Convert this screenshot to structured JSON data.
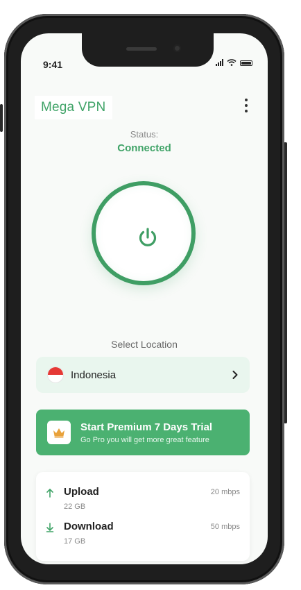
{
  "status_bar": {
    "time": "9:41"
  },
  "app": {
    "title": "Mega VPN",
    "status_label": "Status:",
    "status_value": "Connected"
  },
  "location": {
    "select_label": "Select Location",
    "country": "Indonesia"
  },
  "premium": {
    "title": "Start Premium 7 Days Trial",
    "subtitle": "Go Pro you will get more great feature"
  },
  "stats": {
    "upload": {
      "label": "Upload",
      "amount": "22 GB",
      "speed": "20 mbps"
    },
    "download": {
      "label": "Download",
      "amount": "17 GB",
      "speed": "50 mbps"
    }
  },
  "colors": {
    "accent": "#3fa367",
    "premium_bg": "#4bb171",
    "location_bg": "#e9f6ee",
    "crown": "#e8a13a"
  },
  "icons": [
    "power-icon",
    "menu-icon",
    "chevron-right-icon",
    "crown-icon",
    "arrow-up-icon",
    "arrow-down-icon",
    "flag-icon"
  ]
}
